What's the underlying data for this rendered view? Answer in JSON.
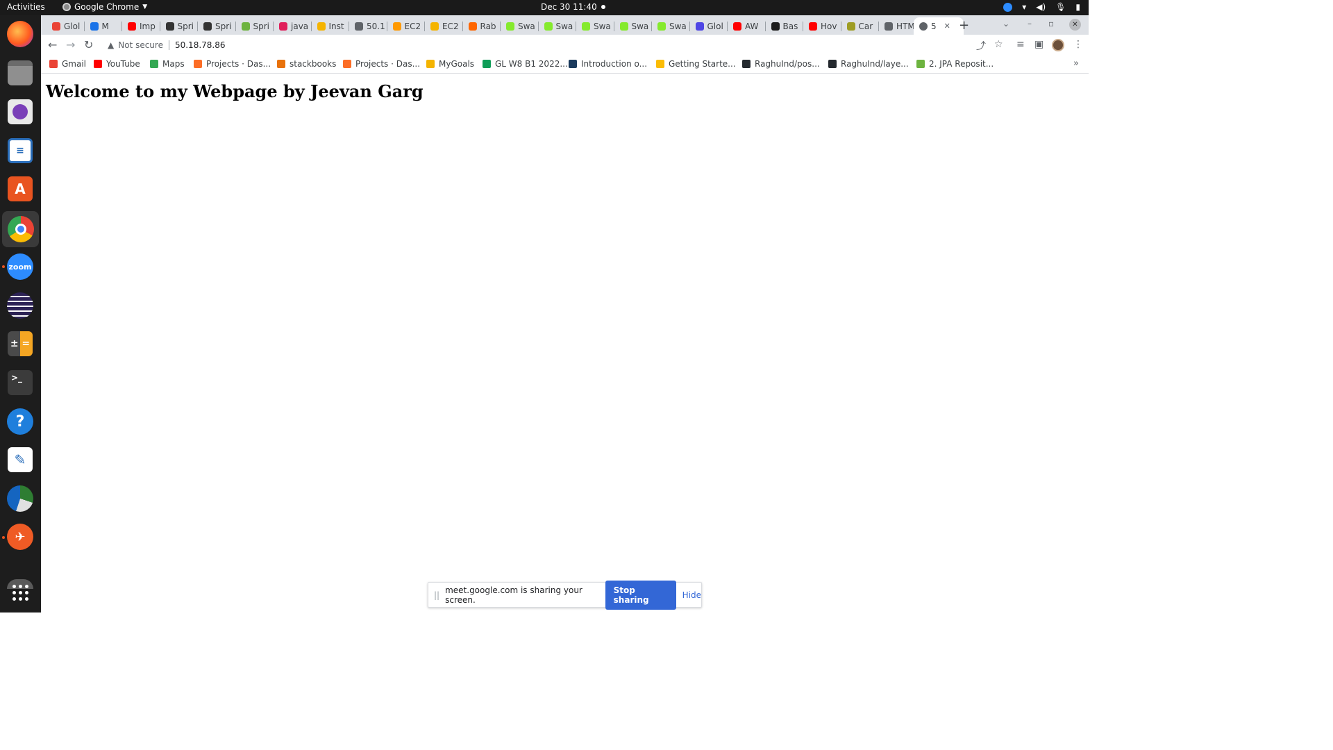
{
  "topbar": {
    "activities": "Activities",
    "app_name": "Google Chrome",
    "clock": "Dec 30  11:40"
  },
  "dock": {
    "items": [
      "firefox-icon",
      "files-icon",
      "screenshot-icon",
      "writer-icon",
      "software-icon",
      "chrome-icon",
      "zoom-icon",
      "eclipse-icon",
      "calculator-icon",
      "terminal-icon",
      "help-icon",
      "text-editor-icon",
      "network-icon",
      "postman-icon",
      "trash-icon",
      "app-grid-icon"
    ],
    "zoom_label": "zoom"
  },
  "tabs": [
    {
      "label": "Glol",
      "color": "#ea4335"
    },
    {
      "label": "M",
      "color": "#1a73e8"
    },
    {
      "label": "Imp",
      "color": "#ff0000"
    },
    {
      "label": "Spri",
      "color": "#333333"
    },
    {
      "label": "Spri",
      "color": "#333333"
    },
    {
      "label": "Spri",
      "color": "#6db33f"
    },
    {
      "label": "java",
      "color": "#e01e5a"
    },
    {
      "label": "Inst",
      "color": "#f5b400"
    },
    {
      "label": "50.1",
      "color": "#5f6368"
    },
    {
      "label": "EC2",
      "color": "#ff9900"
    },
    {
      "label": "EC2",
      "color": "#f5b400"
    },
    {
      "label": "Rab",
      "color": "#f60"
    },
    {
      "label": "Swa",
      "color": "#85ea2d"
    },
    {
      "label": "Swa",
      "color": "#85ea2d"
    },
    {
      "label": "Swa",
      "color": "#85ea2d"
    },
    {
      "label": "Swa",
      "color": "#85ea2d"
    },
    {
      "label": "Swa",
      "color": "#85ea2d"
    },
    {
      "label": "Glol",
      "color": "#4f46e5"
    },
    {
      "label": "AW",
      "color": "#ff0000"
    },
    {
      "label": "Bas",
      "color": "#1c1c1c"
    },
    {
      "label": "Hov",
      "color": "#ff0000"
    },
    {
      "label": "Car",
      "color": "#9e9d24"
    },
    {
      "label": "HTM",
      "color": "#5f6368"
    }
  ],
  "active_tab": {
    "label": "5",
    "close": "✕"
  },
  "toolbar": {
    "security_label": "Not secure",
    "url": "50.18.78.86"
  },
  "bookmarks": [
    {
      "label": "Gmail",
      "color": "#ea4335"
    },
    {
      "label": "YouTube",
      "color": "#ff0000"
    },
    {
      "label": "Maps",
      "color": "#34a853"
    },
    {
      "label": "Projects · Das...",
      "color": "#fc6d26"
    },
    {
      "label": "stackbooks",
      "color": "#e8710a"
    },
    {
      "label": "Projects · Das...",
      "color": "#fc6d26"
    },
    {
      "label": "MyGoals",
      "color": "#f4b400"
    },
    {
      "label": "GL W8 B1 2022...",
      "color": "#0f9d58"
    },
    {
      "label": "Introduction o...",
      "color": "#1a3a5c"
    },
    {
      "label": "Getting Starte...",
      "color": "#fbbc04"
    },
    {
      "label": "RaghuInd/pos...",
      "color": "#24292e"
    },
    {
      "label": "RaghuInd/laye...",
      "color": "#24292e"
    },
    {
      "label": "2. JPA Reposit...",
      "color": "#6db33f"
    }
  ],
  "page": {
    "heading": "Welcome to my Webpage by Jeevan Garg"
  },
  "sharebar": {
    "message": "meet.google.com is sharing your screen.",
    "stop_label": "Stop sharing",
    "hide_label": "Hide"
  }
}
